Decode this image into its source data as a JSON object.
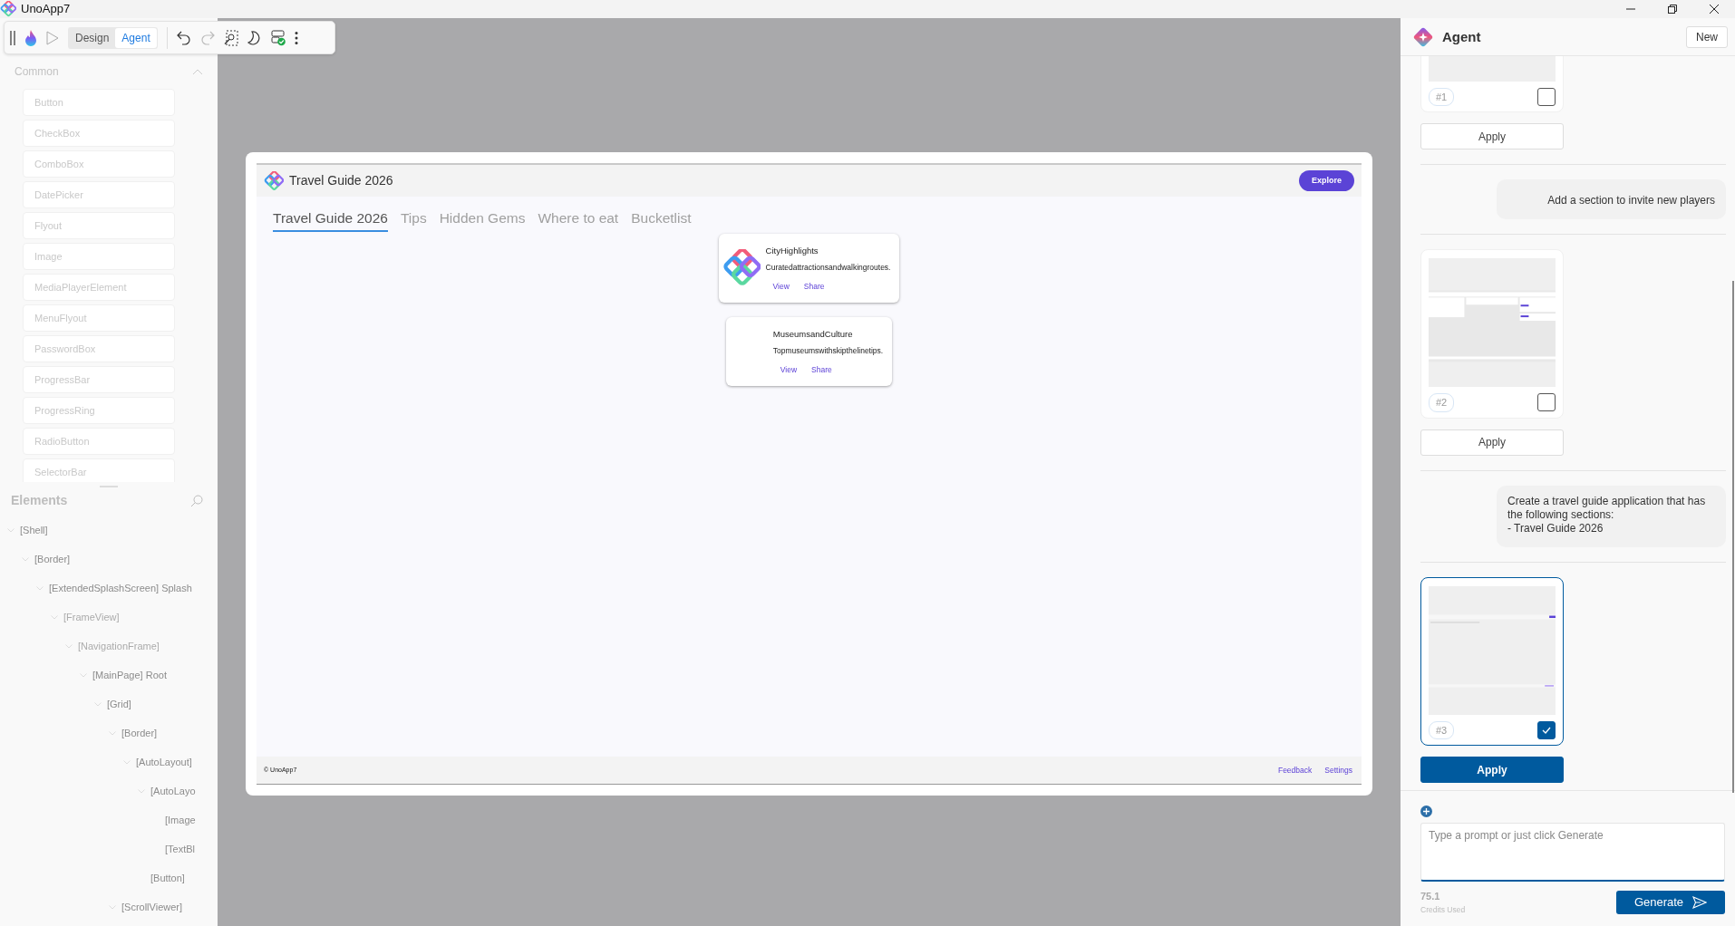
{
  "window": {
    "title": "UnoApp7"
  },
  "toolbar": {
    "modes": [
      {
        "label": "Design",
        "selected": false
      },
      {
        "label": "Agent",
        "selected": true
      }
    ]
  },
  "toolbox": {
    "header": "Common",
    "expanded": true,
    "items": [
      "Button",
      "CheckBox",
      "ComboBox",
      "DatePicker",
      "Flyout",
      "Image",
      "MediaPlayerElement",
      "MenuFlyout",
      "PasswordBox",
      "ProgressBar",
      "ProgressRing",
      "RadioButton",
      "SelectorBar"
    ]
  },
  "elements": {
    "header": "Elements",
    "tree": [
      {
        "label": "[Shell]",
        "expanded": true,
        "dimmed": false,
        "children": [
          {
            "label": "[Border]",
            "expanded": true,
            "dimmed": false,
            "children": [
              {
                "label": "[ExtendedSplashScreen] Splash",
                "expanded": true,
                "dimmed": false,
                "children": [
                  {
                    "label": "[FrameView]",
                    "expanded": true,
                    "dimmed": true,
                    "children": [
                      {
                        "label": "[NavigationFrame]",
                        "expanded": true,
                        "dimmed": true,
                        "children": [
                          {
                            "label": "[MainPage] Root",
                            "expanded": true,
                            "dimmed": false,
                            "children": [
                              {
                                "label": "[Grid]",
                                "expanded": true,
                                "dimmed": false,
                                "children": [
                                  {
                                    "label": "[Border]",
                                    "expanded": true,
                                    "dimmed": false,
                                    "children": [
                                      {
                                        "label": "[AutoLayout]",
                                        "expanded": true,
                                        "dimmed": false,
                                        "children": [
                                          {
                                            "label": "[AutoLayo",
                                            "expanded": true,
                                            "dimmed": false,
                                            "children": [
                                              {
                                                "label": "[Image",
                                                "expanded": false,
                                                "dimmed": false
                                              },
                                              {
                                                "label": "[TextBl",
                                                "expanded": false,
                                                "dimmed": false
                                              }
                                            ]
                                          },
                                          {
                                            "label": "[Button]",
                                            "expanded": false,
                                            "dimmed": false
                                          }
                                        ]
                                      }
                                    ]
                                  },
                                  {
                                    "label": "[ScrollViewer]",
                                    "expanded": true,
                                    "dimmed": false
                                  }
                                ]
                              }
                            ]
                          }
                        ]
                      }
                    ]
                  }
                ]
              }
            ]
          }
        ]
      }
    ]
  },
  "app": {
    "title": "Travel Guide 2026",
    "action_button": "Explore",
    "tabs": [
      {
        "label": "Travel Guide 2026",
        "selected": true
      },
      {
        "label": "Tips",
        "selected": false
      },
      {
        "label": "Hidden Gems",
        "selected": false
      },
      {
        "label": "Where to eat",
        "selected": false
      },
      {
        "label": "Bucketlist",
        "selected": false
      }
    ],
    "cards": [
      {
        "kind": "logo",
        "title": "CityHighlights",
        "description": "Curatedattractionsandwalkingroutes.",
        "actions": [
          "View",
          "Share"
        ]
      },
      {
        "kind": "plain",
        "title": "MuseumsandCulture",
        "description": "Topmuseumswithskipthelinetips.",
        "actions": [
          "View",
          "Share"
        ]
      }
    ],
    "footer": {
      "copyright": "© UnoApp7",
      "links": [
        "Feedback",
        "Settings"
      ]
    }
  },
  "agent": {
    "title": "Agent",
    "new_button": "New",
    "conversation": [
      {
        "kind": "result",
        "badge": "#1",
        "selected": false,
        "button": "Apply"
      },
      {
        "kind": "message",
        "text": "Add a section to invite new players"
      },
      {
        "kind": "result",
        "badge": "#2",
        "selected": false,
        "button": "Apply"
      },
      {
        "kind": "message",
        "text": "Create a travel guide application that has the following sections:\n- Travel Guide 2026"
      },
      {
        "kind": "result",
        "badge": "#3",
        "selected": true,
        "button": "Apply"
      }
    ],
    "prompt": {
      "placeholder": "Type a prompt or just click Generate"
    },
    "credits": {
      "value": "75.1",
      "label": "Credits Used"
    },
    "generate_button": "Generate"
  }
}
